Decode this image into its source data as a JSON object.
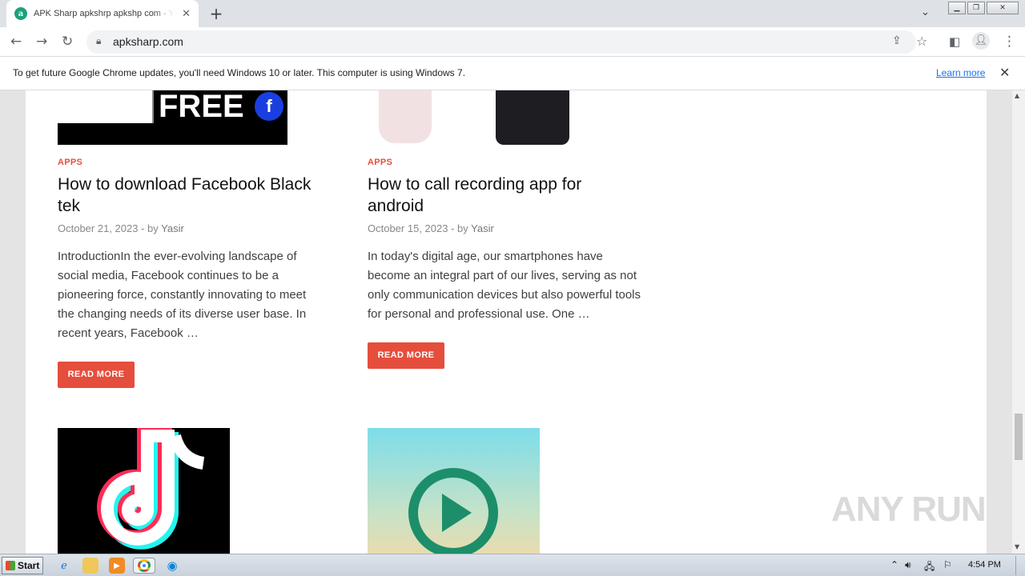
{
  "browser": {
    "tab_title": "APK Sharp apkshrp apkshp com - Your",
    "tab_favicon_letter": "a",
    "url": "apksharp.com",
    "infobar_message": "To get future Google Chrome updates, you'll need Windows 10 or later. This computer is using Windows 7.",
    "infobar_link": "Learn more"
  },
  "posts": [
    {
      "category": "APPS",
      "title_line1": "How to download Facebook Black",
      "title_line2": "tek",
      "date": "October 21, 2023",
      "by": "by",
      "author": "Yasir",
      "excerpt": "IntroductionIn the ever-evolving landscape of social media, Facebook continues to be a pioneering force, constantly innovating to meet the changing needs of its diverse user base. In recent years, Facebook …",
      "read_more": "READ MORE",
      "thumb_text": "FREE",
      "thumb_badge": "f"
    },
    {
      "category": "APPS",
      "title_line1": "How to call recording app for",
      "title_line2": "android",
      "date": "October 15, 2023",
      "by": "by",
      "author": "Yasir",
      "excerpt": "In today's digital age, our smartphones have become an integral part of our lives, serving as not only communication devices but also powerful tools for personal and professional use. One …",
      "read_more": "READ MORE"
    }
  ],
  "watermark": "ANY RUN",
  "taskbar": {
    "start_label": "Start",
    "clock": "4:54 PM"
  },
  "colors": {
    "accent": "#e54e3c",
    "link": "#1a73e8"
  }
}
